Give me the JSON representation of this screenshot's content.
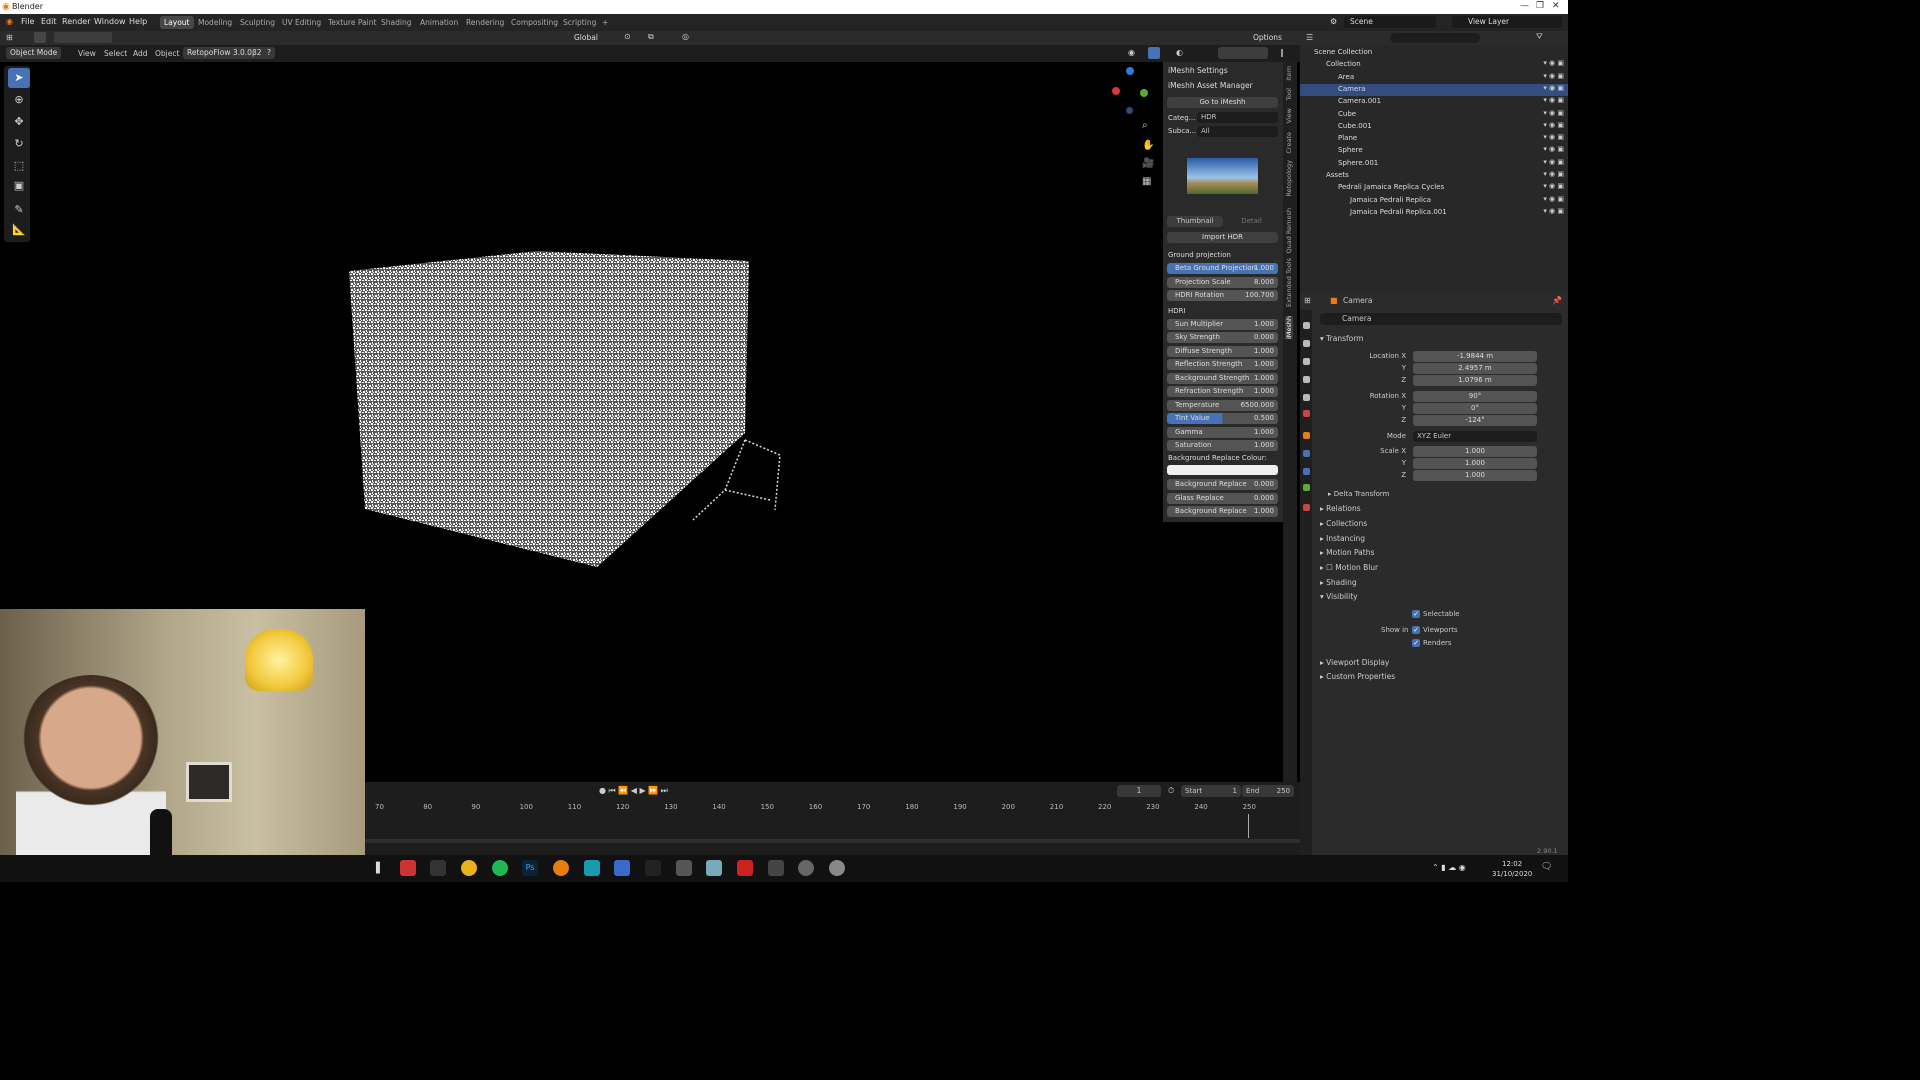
{
  "window": {
    "title": "Blender"
  },
  "menu": [
    "File",
    "Edit",
    "Render",
    "Window",
    "Help"
  ],
  "workspaces": [
    "Layout",
    "Modeling",
    "Sculpting",
    "UV Editing",
    "Texture Paint",
    "Shading",
    "Animation",
    "Rendering",
    "Compositing",
    "Scripting",
    "+"
  ],
  "scene": {
    "label": "Scene",
    "view_layer": "View Layer"
  },
  "toolbar": {
    "orientation": "Global",
    "options": "Options"
  },
  "header": {
    "mode": "Object Mode",
    "view": "View",
    "select": "Select",
    "add": "Add",
    "object": "Object",
    "addon": "RetopoFlow 3.0.0β2",
    "help": "?"
  },
  "npanel": {
    "settings": "iMeshh Settings",
    "asset_manager": "iMeshh Asset Manager",
    "goto": "Go to iMeshh",
    "category_label": "Categ...",
    "category": "HDR",
    "subcategory_label": "Subca...",
    "subcategory": "All",
    "thumb_tab": "Thumbnail",
    "detail_tab": "Detail",
    "import": "Import HDR",
    "ground_title": "Ground projection",
    "ground": [
      {
        "label": "Beta Ground Projection",
        "value": "1.000"
      },
      {
        "label": "Projection Scale",
        "value": "8.000"
      },
      {
        "label": "HDRI Rotation",
        "value": "100.700"
      }
    ],
    "hdri_title": "HDRI",
    "hdri": [
      {
        "label": "Sun Multiplier",
        "value": "1.000"
      },
      {
        "label": "Sky Strength",
        "value": "0.000"
      },
      {
        "label": "Diffuse Strength",
        "value": "1.000"
      },
      {
        "label": "Reflection Strength",
        "value": "1.000"
      },
      {
        "label": "Background Strength",
        "value": "1.000"
      },
      {
        "label": "Refraction Strength",
        "value": "1.000"
      },
      {
        "label": "Temperature",
        "value": "6500.000"
      },
      {
        "label": "Tint Value",
        "value": "0.500"
      },
      {
        "label": "Gamma",
        "value": "1.000"
      },
      {
        "label": "Saturation",
        "value": "1.000"
      }
    ],
    "bg_colour": "Background Replace Colour:",
    "extra": [
      {
        "label": "Background Replace",
        "value": "0.000"
      },
      {
        "label": "Glass Replace",
        "value": "0.000"
      },
      {
        "label": "Background Replace",
        "value": "1.000"
      }
    ]
  },
  "sidetabs": [
    "Item",
    "Tool",
    "View",
    "Create",
    "Retopology",
    "Quad Remesh",
    "Extended Tools",
    "iMeshh"
  ],
  "outliner": [
    {
      "name": "Scene Collection",
      "indent": 0
    },
    {
      "name": "Collection",
      "indent": 1
    },
    {
      "name": "Area",
      "indent": 2
    },
    {
      "name": "Camera",
      "indent": 2,
      "selected": true
    },
    {
      "name": "Camera.001",
      "indent": 2
    },
    {
      "name": "Cube",
      "indent": 2
    },
    {
      "name": "Cube.001",
      "indent": 2
    },
    {
      "name": "Plane",
      "indent": 2
    },
    {
      "name": "Sphere",
      "indent": 2
    },
    {
      "name": "Sphere.001",
      "indent": 2
    },
    {
      "name": "Assets",
      "indent": 1
    },
    {
      "name": "Pedrali Jamaica Replica Cycles",
      "indent": 2
    },
    {
      "name": "Jamaica Pedrali Replica",
      "indent": 3
    },
    {
      "name": "Jamaica Pedrali Replica.001",
      "indent": 3
    }
  ],
  "props": {
    "object": "Camera",
    "name": "Camera",
    "transform": "Transform",
    "loc_label": "Location X",
    "loc": [
      "-1.9844 m",
      "2.4957 m",
      "1.0796 m"
    ],
    "rot_label": "Rotation X",
    "rot": [
      "90°",
      "0°",
      "-124°"
    ],
    "mode_label": "Mode",
    "mode": "XYZ Euler",
    "scale_label": "Scale X",
    "scale": [
      "1.000",
      "1.000",
      "1.000"
    ],
    "y": "Y",
    "z": "Z",
    "delta": "Delta Transform",
    "sections": [
      "Relations",
      "Collections",
      "Instancing",
      "Motion Paths",
      "Motion Blur",
      "Shading",
      "Visibility"
    ],
    "selectable": "Selectable",
    "show_in": "Show in",
    "viewports": "Viewports",
    "renders": "Renders",
    "sections2": [
      "Viewport Display",
      "Custom Properties"
    ],
    "version": "2.90.1"
  },
  "timeline": {
    "frame": "1",
    "start_label": "Start",
    "start": "1",
    "end_label": "End",
    "end": "250",
    "ticks": [
      "70",
      "80",
      "90",
      "100",
      "110",
      "120",
      "130",
      "140",
      "150",
      "160",
      "170",
      "180",
      "190",
      "200",
      "210",
      "220",
      "230",
      "240",
      "250"
    ]
  },
  "taskbar": {
    "time": "12:02",
    "date": "31/10/2020"
  },
  "colors": {
    "accent": "#4772b3",
    "selected": "#334d80"
  }
}
